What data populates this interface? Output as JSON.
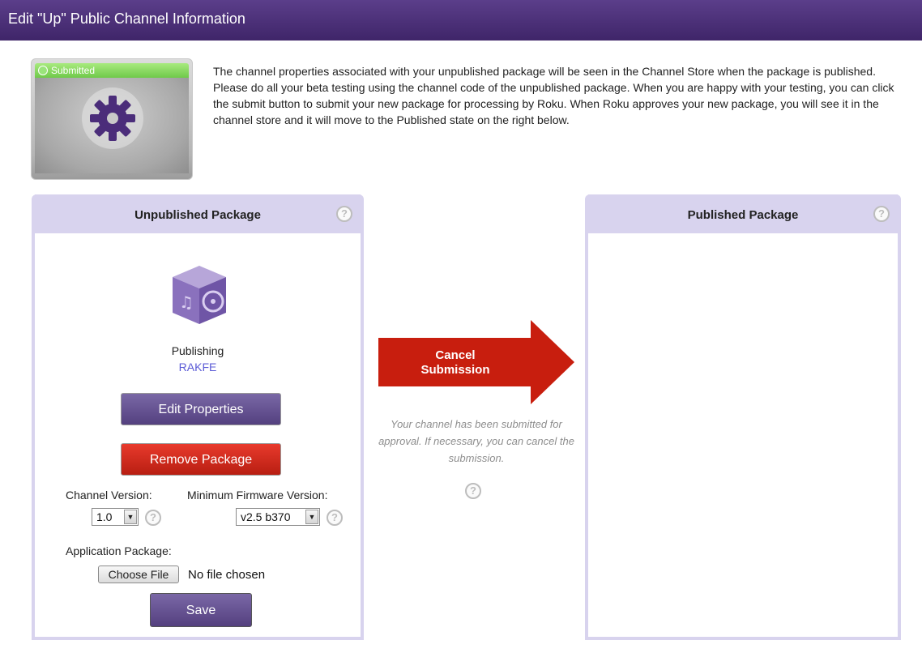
{
  "header": {
    "title": "Edit \"Up\" Public Channel Information"
  },
  "status_tile": {
    "badge": "Submitted",
    "icon": "gear-icon"
  },
  "intro": {
    "text": "The channel properties associated with your unpublished package will be seen in the Channel Store when the package is published. Please do all your beta testing using the channel code of the unpublished package. When you are happy with your testing, you can click the submit button to submit your new package for processing by Roku. When Roku approves your new package, you will see it in the channel store and it will move to the Published state on the right below."
  },
  "unpublished": {
    "title": "Unpublished Package",
    "status": "Publishing",
    "code": "RAKFE",
    "edit_label": "Edit Properties",
    "remove_label": "Remove Package",
    "channel_version_label": "Channel Version:",
    "channel_version_value": "1.0",
    "firmware_label": "Minimum Firmware Version:",
    "firmware_value": "v2.5 b370",
    "app_package_label": "Application Package:",
    "choose_file_label": "Choose File",
    "no_file_text": "No file chosen",
    "save_label": "Save"
  },
  "center": {
    "cancel_label_1": "Cancel",
    "cancel_label_2": "Submission",
    "note": "Your channel has been submitted for approval. If necessary, you can cancel the submission."
  },
  "published": {
    "title": "Published Package"
  },
  "help_glyph": "?",
  "colors": {
    "header": "#4a2f78",
    "panel_border": "#d8d3ee",
    "arrow": "#c81e0e",
    "submitted_green": "#7dd35a",
    "code_link": "#5b5bd6"
  }
}
